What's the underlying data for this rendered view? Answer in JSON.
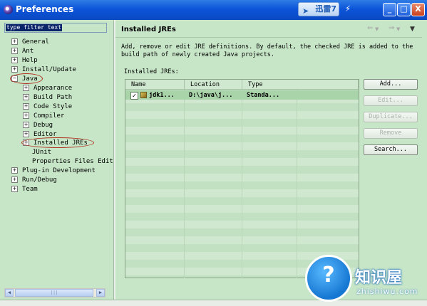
{
  "window": {
    "title": "Preferences",
    "xunlei_badge": "迅雷7",
    "buttons": {
      "minimize": "_",
      "maximize": "□",
      "close": "X"
    }
  },
  "filter": {
    "value": "type filter text"
  },
  "tree": [
    {
      "label": "General",
      "expander": "+"
    },
    {
      "label": "Ant",
      "expander": "+"
    },
    {
      "label": "Help",
      "expander": "+"
    },
    {
      "label": "Install/Update",
      "expander": "+"
    },
    {
      "label": "Java",
      "expander": "−"
    },
    {
      "label": "Appearance",
      "expander": "+"
    },
    {
      "label": "Build Path",
      "expander": "+"
    },
    {
      "label": "Code Style",
      "expander": "+"
    },
    {
      "label": "Compiler",
      "expander": "+"
    },
    {
      "label": "Debug",
      "expander": "+"
    },
    {
      "label": "Editor",
      "expander": "+"
    },
    {
      "label": "Installed JREs",
      "expander": "+"
    },
    {
      "label": "JUnit",
      "expander": ""
    },
    {
      "label": "Properties Files Edit",
      "expander": ""
    },
    {
      "label": "Plug-in Development",
      "expander": "+"
    },
    {
      "label": "Run/Debug",
      "expander": "+"
    },
    {
      "label": "Team",
      "expander": "+"
    }
  ],
  "header": {
    "title": "Installed JREs"
  },
  "description": "Add, remove or edit JRE definitions. By default, the checked JRE is added to the build path of newly created Java projects.",
  "jre_table": {
    "label": "Installed JREs:",
    "columns": [
      "Name",
      "Location",
      "Type"
    ],
    "rows": [
      {
        "checked": true,
        "name": "jdk1...",
        "location": "D:\\java\\j...",
        "type": "Standa..."
      }
    ]
  },
  "buttons": [
    {
      "label": "Add...",
      "enabled": true
    },
    {
      "label": "Edit...",
      "enabled": false
    },
    {
      "label": "Duplicate...",
      "enabled": false
    },
    {
      "label": "Remove",
      "enabled": false
    },
    {
      "label": "Search...",
      "enabled": true
    }
  ],
  "watermark": {
    "glyph": "?",
    "cn": "知识屋",
    "en": "zhishiwu.com"
  },
  "colors": {
    "titlebar": "#0c54d9",
    "background": "#c7e6c7",
    "highlight_oval": "#b03020",
    "selection": "#0a246a"
  }
}
